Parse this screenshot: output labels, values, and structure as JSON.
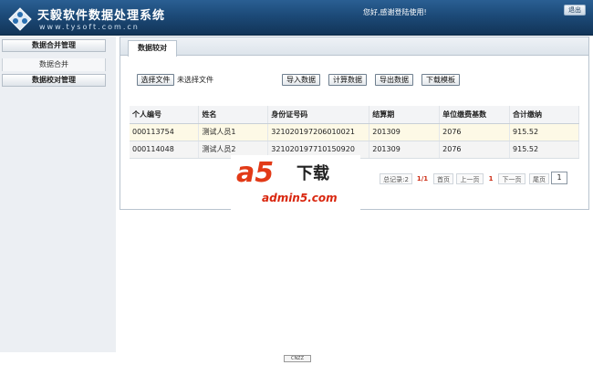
{
  "header": {
    "app_title": "天毅软件数据处理系统",
    "app_url": "www.tysoft.com.cn",
    "greeting": "您好,感谢登陆使用!",
    "logout_label": "退出"
  },
  "sidebar": {
    "groups": [
      {
        "label": "数据合并管理",
        "items": [
          {
            "label": "数据合并"
          }
        ]
      },
      {
        "label": "数据校对管理",
        "items": []
      }
    ]
  },
  "main": {
    "tab_label": "数据较对",
    "file": {
      "button_label": "选择文件",
      "status": "未选择文件"
    },
    "actions": {
      "import_label": "导入数据",
      "calc_label": "计算数据",
      "export_label": "导出数据",
      "download_label": "下载模板"
    },
    "table": {
      "columns": [
        "个人编号",
        "姓名",
        "身份证号码",
        "结算期",
        "单位缴费基数",
        "合计缴纳"
      ],
      "rows": [
        [
          "000113754",
          "测试人员1",
          "321020197206010021",
          "201309",
          "2076",
          "915.52"
        ],
        [
          "000114048",
          "测试人员2",
          "321020197710150920",
          "201309",
          "2076",
          "915.52"
        ]
      ]
    },
    "pager": {
      "total": "总记录:2",
      "pages": "1/1",
      "first": "首页",
      "prev": "上一页",
      "current": "1",
      "next": "下一页",
      "last": "尾页",
      "jump_value": "1"
    }
  },
  "watermark": {
    "brand": "a5",
    "brand_suffix": "下载",
    "url": "admin5.com"
  },
  "footer": {
    "badge": "CNZZ"
  },
  "colors": {
    "header_bg": "#1c4a78",
    "highlight_row": "#fdf9e6",
    "pager_accent": "#cc2a12",
    "watermark_red": "#e23a17"
  }
}
